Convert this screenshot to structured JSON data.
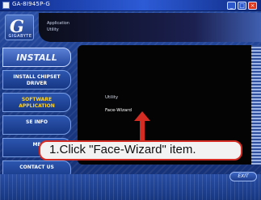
{
  "window": {
    "title": "GA-8I945P-G",
    "controls": {
      "minimize": "_",
      "maximize": "□",
      "close": "×"
    }
  },
  "header": {
    "logo_glyph": "G",
    "logo_brand": "GIGABYTE",
    "banner_line1": "Application",
    "banner_line2": "Utility"
  },
  "sidebar": {
    "items": [
      {
        "label": "INSTALL"
      },
      {
        "label": "INSTALL CHIPSET DRIVER"
      },
      {
        "label": "SOFTWARE APPLICATION"
      },
      {
        "label": "SE INFO"
      },
      {
        "label": "ME"
      },
      {
        "label": "CONTACT US"
      }
    ]
  },
  "content": {
    "menu_items": [
      {
        "label": "Utility"
      },
      {
        "label": "Face-Wizard"
      }
    ]
  },
  "callout": {
    "text": "1.Click \"Face-Wizard\" item."
  },
  "footer": {
    "exit_label": "EXIT"
  },
  "colors": {
    "accent_red": "#d42c22",
    "panel_bg": "#040404",
    "frame_blue": "#1d3f86"
  }
}
